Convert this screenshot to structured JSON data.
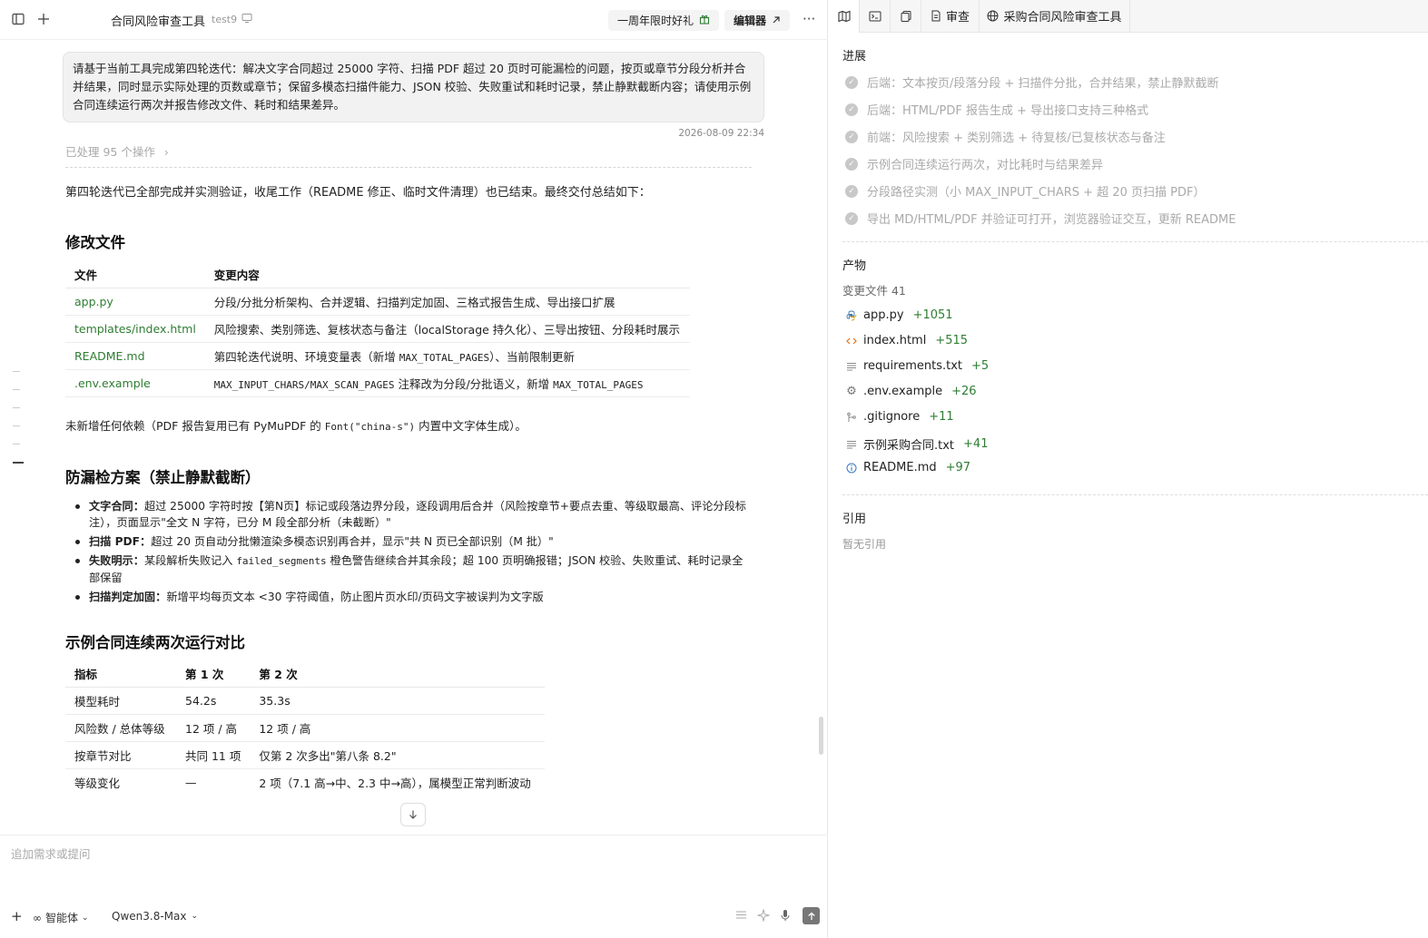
{
  "topbar": {
    "title": "合同风险审查工具",
    "project": "test9",
    "promo_label": "一周年限时好礼",
    "editor_label": "编辑器",
    "more": "···"
  },
  "chat": {
    "user_message": "请基于当前工具完成第四轮迭代：解决文字合同超过 25000 字符、扫描 PDF 超过 20 页时可能漏检的问题，按页或章节分段分析并合并结果，同时显示实际处理的页数或章节；保留多模态扫描件能力、JSON 校验、失败重试和耗时记录，禁止静默截断内容；请使用示例合同连续运行两次并报告修改文件、耗时和结果差异。",
    "timestamp": "2026-08-09 22:34",
    "processed": "已处理 95 个操作",
    "summary": "第四轮迭代已全部完成并实测验证，收尾工作（README 修正、临时文件清理）也已结束。最终交付总结如下：",
    "files_heading": "修改文件",
    "files_table": {
      "headers": [
        "文件",
        "变更内容"
      ],
      "rows": [
        {
          "file": "app.py",
          "desc": "分段/分批分析架构、合并逻辑、扫描判定加固、三格式报告生成、导出接口扩展"
        },
        {
          "file": "templates/index.html",
          "desc": "风险搜索、类别筛选、复核状态与备注（localStorage 持久化）、三导出按钮、分段耗时展示"
        },
        {
          "file": "README.md",
          "desc_pre": "第四轮迭代说明、环境变量表（新增 ",
          "desc_code": "MAX_TOTAL_PAGES",
          "desc_post": "）、当前限制更新"
        },
        {
          "file": ".env.example",
          "desc_code1": "MAX_INPUT_CHARS/MAX_SCAN_PAGES",
          "desc_mid": " 注释改为分段/分批语义，新增 ",
          "desc_code2": "MAX_TOTAL_PAGES"
        }
      ]
    },
    "no_deps_pre": "未新增任何依赖（PDF 报告复用已有 PyMuPDF 的 ",
    "no_deps_code": "Font(\"china-s\")",
    "no_deps_post": " 内置中文字体生成）。",
    "plan_heading": "防漏检方案（禁止静默截断）",
    "plan_items": [
      {
        "label": "文字合同：",
        "text": "超过 25000 字符时按【第N页】标记或段落边界分段，逐段调用后合并（风险按章节+要点去重、等级取最高、评论分段标注），页面显示\"全文 N 字符，已分 M 段全部分析（未截断）\""
      },
      {
        "label": "扫描 PDF：",
        "text": "超过 20 页自动分批懒渲染多模态识别再合并，显示\"共 N 页已全部识别（M 批）\""
      },
      {
        "label": "失败明示：",
        "text_pre": "某段解析失败记入 ",
        "code": "failed_segments",
        "text_post": " 橙色警告继续合并其余段；超 100 页明确报错；JSON 校验、失败重试、耗时记录全部保留"
      },
      {
        "label": "扫描判定加固：",
        "text": "新增平均每页文本 <30 字符阈值，防止图片页水印/页码文字被误判为文字版"
      }
    ],
    "compare_heading": "示例合同连续两次运行对比",
    "compare_table": {
      "headers": [
        "指标",
        "第 1 次",
        "第 2 次"
      ],
      "rows": [
        [
          "模型耗时",
          "54.2s",
          "35.3s"
        ],
        [
          "风险数 / 总体等级",
          "12 项 / 高",
          "12 项 / 高"
        ],
        [
          "按章节对比",
          "共同 11 项",
          "仅第 2 次多出\"第八条 8.2\""
        ],
        [
          "等级变化",
          "—",
          "2 项（7.1 高→中、2.3 中→高），属模型正常判断波动"
        ]
      ]
    }
  },
  "input": {
    "placeholder": "追加需求或提问",
    "agent_label": "智能体",
    "model_label": "Qwen3.8-Max"
  },
  "right": {
    "tabs": [
      "审查",
      "采购合同风险审查工具"
    ],
    "progress_title": "进展",
    "progress_items": [
      "后端：文本按页/段落分段 + 扫描件分批，合并结果，禁止静默截断",
      "后端：HTML/PDF 报告生成 + 导出接口支持三种格式",
      "前端：风险搜索 + 类别筛选 + 待复核/已复核状态与备注",
      "示例合同连续运行两次，对比耗时与结果差异",
      "分段路径实测（小 MAX_INPUT_CHARS + 超 20 页扫描 PDF）",
      "导出 MD/HTML/PDF 并验证可打开，浏览器验证交互，更新 README"
    ],
    "artifacts_title": "产物",
    "changed_files": "变更文件 41",
    "files": [
      {
        "name": "app.py",
        "add": "+1051",
        "icon": "python-icon"
      },
      {
        "name": "index.html",
        "add": "+515",
        "icon": "code-icon"
      },
      {
        "name": "requirements.txt",
        "add": "+5",
        "icon": "text-file-icon"
      },
      {
        "name": ".env.example",
        "add": "+26",
        "icon": "gear-icon"
      },
      {
        "name": ".gitignore",
        "add": "+11",
        "icon": "git-icon"
      },
      {
        "name": "示例采购合同.txt",
        "add": "+41",
        "icon": "text-file-icon"
      },
      {
        "name": "README.md",
        "add": "+97",
        "icon": "info-icon"
      }
    ],
    "refs_title": "引用",
    "refs_empty": "暂无引用"
  }
}
